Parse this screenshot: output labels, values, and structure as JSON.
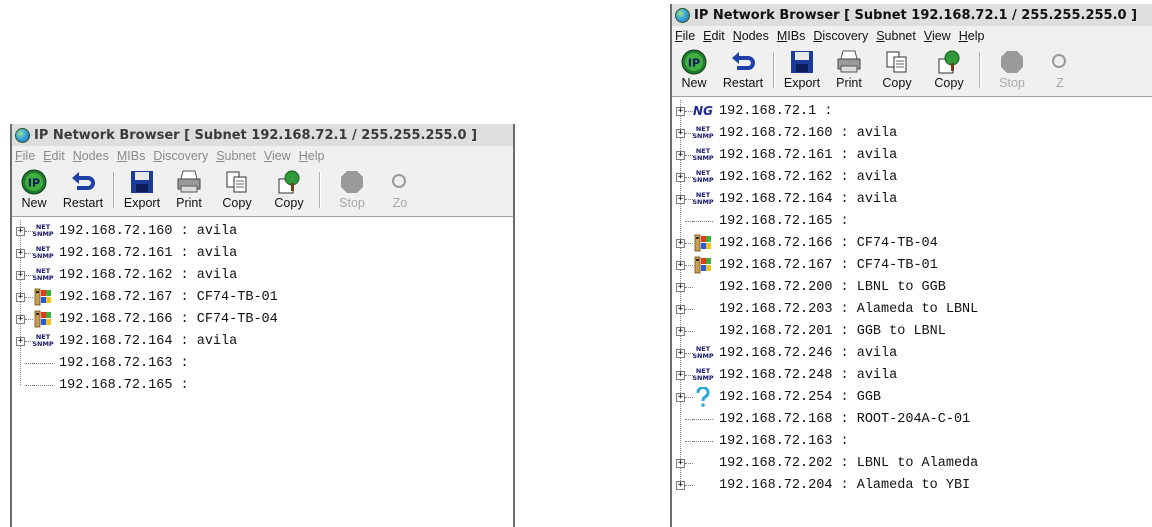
{
  "left_window": {
    "title": "IP Network Browser [ Subnet 192.168.72.1 / 255.255.255.0 ]",
    "menu": [
      "File",
      "Edit",
      "Nodes",
      "MIBs",
      "Discovery",
      "Subnet",
      "View",
      "Help"
    ],
    "toolbar": [
      {
        "label": "New",
        "icon": "ip-icon"
      },
      {
        "label": "Restart",
        "icon": "restart-arrow-icon"
      },
      {
        "label": "Export",
        "icon": "floppy-disk-icon"
      },
      {
        "label": "Print",
        "icon": "printer-icon"
      },
      {
        "label": "Copy",
        "icon": "copy-pages-icon"
      },
      {
        "label": "Copy",
        "icon": "copy-tree-icon"
      },
      {
        "label": "Stop",
        "icon": "stop-icon"
      },
      {
        "label": "Zo",
        "icon": "zoom-icon"
      }
    ],
    "nodes": [
      {
        "ip": "192.168.72.160",
        "name": "avila",
        "icon": "net-snmp"
      },
      {
        "ip": "192.168.72.161",
        "name": "avila",
        "icon": "net-snmp"
      },
      {
        "ip": "192.168.72.162",
        "name": "avila",
        "icon": "net-snmp"
      },
      {
        "ip": "192.168.72.167",
        "name": "CF74-TB-01",
        "icon": "windows"
      },
      {
        "ip": "192.168.72.166",
        "name": "CF74-TB-04",
        "icon": "windows"
      },
      {
        "ip": "192.168.72.164",
        "name": "avila",
        "icon": "net-snmp"
      },
      {
        "ip": "192.168.72.163",
        "name": "",
        "icon": "none"
      },
      {
        "ip": "192.168.72.165",
        "name": "",
        "icon": "none"
      }
    ]
  },
  "right_window": {
    "title": "IP Network Browser [ Subnet 192.168.72.1 / 255.255.255.0 ]",
    "menu": [
      "File",
      "Edit",
      "Nodes",
      "MIBs",
      "Discovery",
      "Subnet",
      "View",
      "Help"
    ],
    "toolbar": [
      {
        "label": "New",
        "icon": "ip-icon"
      },
      {
        "label": "Restart",
        "icon": "restart-arrow-icon"
      },
      {
        "label": "Export",
        "icon": "floppy-disk-icon"
      },
      {
        "label": "Print",
        "icon": "printer-icon"
      },
      {
        "label": "Copy",
        "icon": "copy-pages-icon"
      },
      {
        "label": "Copy",
        "icon": "copy-tree-icon"
      },
      {
        "label": "Stop",
        "icon": "stop-icon"
      },
      {
        "label": "Z",
        "icon": "zoom-icon"
      }
    ],
    "nodes": [
      {
        "ip": "192.168.72.1",
        "name": "",
        "icon": "ng",
        "expandable": true
      },
      {
        "ip": "192.168.72.160",
        "name": "avila",
        "icon": "net-snmp",
        "expandable": true
      },
      {
        "ip": "192.168.72.161",
        "name": "avila",
        "icon": "net-snmp",
        "expandable": true
      },
      {
        "ip": "192.168.72.162",
        "name": "avila",
        "icon": "net-snmp",
        "expandable": true
      },
      {
        "ip": "192.168.72.164",
        "name": "avila",
        "icon": "net-snmp",
        "expandable": true
      },
      {
        "ip": "192.168.72.165",
        "name": "",
        "icon": "none",
        "expandable": false
      },
      {
        "ip": "192.168.72.166",
        "name": "CF74-TB-04",
        "icon": "windows",
        "expandable": true
      },
      {
        "ip": "192.168.72.167",
        "name": "CF74-TB-01",
        "icon": "windows",
        "expandable": true
      },
      {
        "ip": "192.168.72.200",
        "name": "LBNL to GGB",
        "icon": "blank",
        "expandable": true
      },
      {
        "ip": "192.168.72.203",
        "name": "Alameda to LBNL",
        "icon": "blank",
        "expandable": true
      },
      {
        "ip": "192.168.72.201",
        "name": "GGB to LBNL",
        "icon": "blank",
        "expandable": true
      },
      {
        "ip": "192.168.72.246",
        "name": "avila",
        "icon": "net-snmp",
        "expandable": true
      },
      {
        "ip": "192.168.72.248",
        "name": "avila",
        "icon": "net-snmp",
        "expandable": true
      },
      {
        "ip": "192.168.72.254",
        "name": "GGB",
        "icon": "question",
        "expandable": true
      },
      {
        "ip": "192.168.72.168",
        "name": "ROOT-204A-C-01",
        "icon": "none",
        "expandable": false
      },
      {
        "ip": "192.168.72.163",
        "name": "",
        "icon": "none",
        "expandable": false
      },
      {
        "ip": "192.168.72.202",
        "name": "LBNL to Alameda",
        "icon": "blank",
        "expandable": true
      },
      {
        "ip": "192.168.72.204",
        "name": "Alameda to YBI",
        "icon": "blank",
        "expandable": true
      }
    ]
  },
  "icon_labels": {
    "net_snmp_top": "NET",
    "net_snmp_bottom": "SNMP",
    "ng": "NG",
    "ip_badge": "IP",
    "tree_toggle": "+"
  }
}
